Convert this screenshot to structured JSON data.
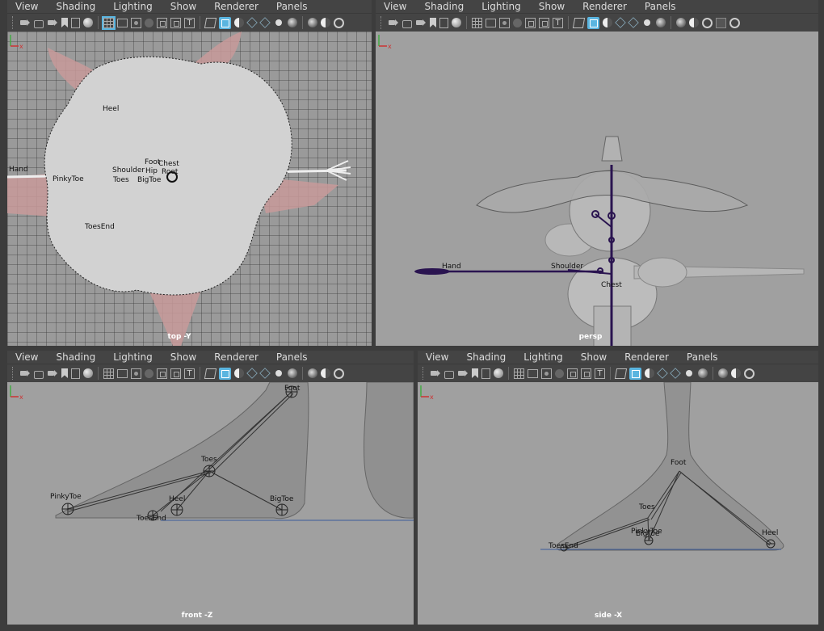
{
  "menu": [
    "View",
    "Shading",
    "Lighting",
    "Show",
    "Renderer",
    "Panels"
  ],
  "axis_labels": {
    "x": "x",
    "y": "y",
    "z": "z"
  },
  "panels": {
    "top": {
      "view_label": "top -Y",
      "joints": [
        "Heel",
        "Hand",
        "PinkyToe",
        "Shoulder",
        "Toes",
        "Foot",
        "Chest",
        "Hip",
        "Root",
        "BigToe",
        "ToesEnd"
      ]
    },
    "persp": {
      "view_label": "persp",
      "joints": [
        "Hand",
        "Shoulder",
        "Chest"
      ]
    },
    "front": {
      "view_label": "front -Z",
      "joints": [
        "Foot",
        "Toes",
        "PinkyToe",
        "Heel",
        "BigToe",
        "ToesEnd"
      ]
    },
    "side": {
      "view_label": "side -X",
      "joints": [
        "Foot",
        "Toes",
        "PinkyToe",
        "BigToe",
        "Heel",
        "ToesEnd"
      ]
    }
  },
  "colors": {
    "accent": "#5ab5e0",
    "viewport_bg": "#9f9f9f",
    "joint": "#2a1450"
  }
}
